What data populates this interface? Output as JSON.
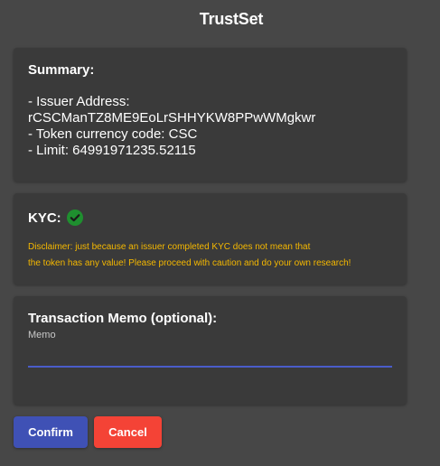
{
  "header": {
    "title": "TrustSet"
  },
  "summary": {
    "heading": "Summary:",
    "issuer_label": "- Issuer Address:",
    "issuer_address": "rCSCManTZ8ME9EoLrSHHYKW8PPwWMgkwr",
    "currency_line": "- Token currency code: CSC",
    "limit_line": "- Limit: 64991971235.52115"
  },
  "kyc": {
    "heading": "KYC:",
    "status_icon": "check-circle-icon",
    "status_color": "#1f8f2f",
    "disclaimer_line1": "Disclaimer: just because an issuer completed KYC does not mean that",
    "disclaimer_line2": "the token has any value! Please proceed with caution and do your own research!"
  },
  "memo": {
    "heading": "Transaction Memo (optional):",
    "label": "Memo",
    "value": "",
    "placeholder": ""
  },
  "actions": {
    "confirm_label": "Confirm",
    "cancel_label": "Cancel",
    "confirm_color": "#3f51b5",
    "cancel_color": "#f44336"
  }
}
